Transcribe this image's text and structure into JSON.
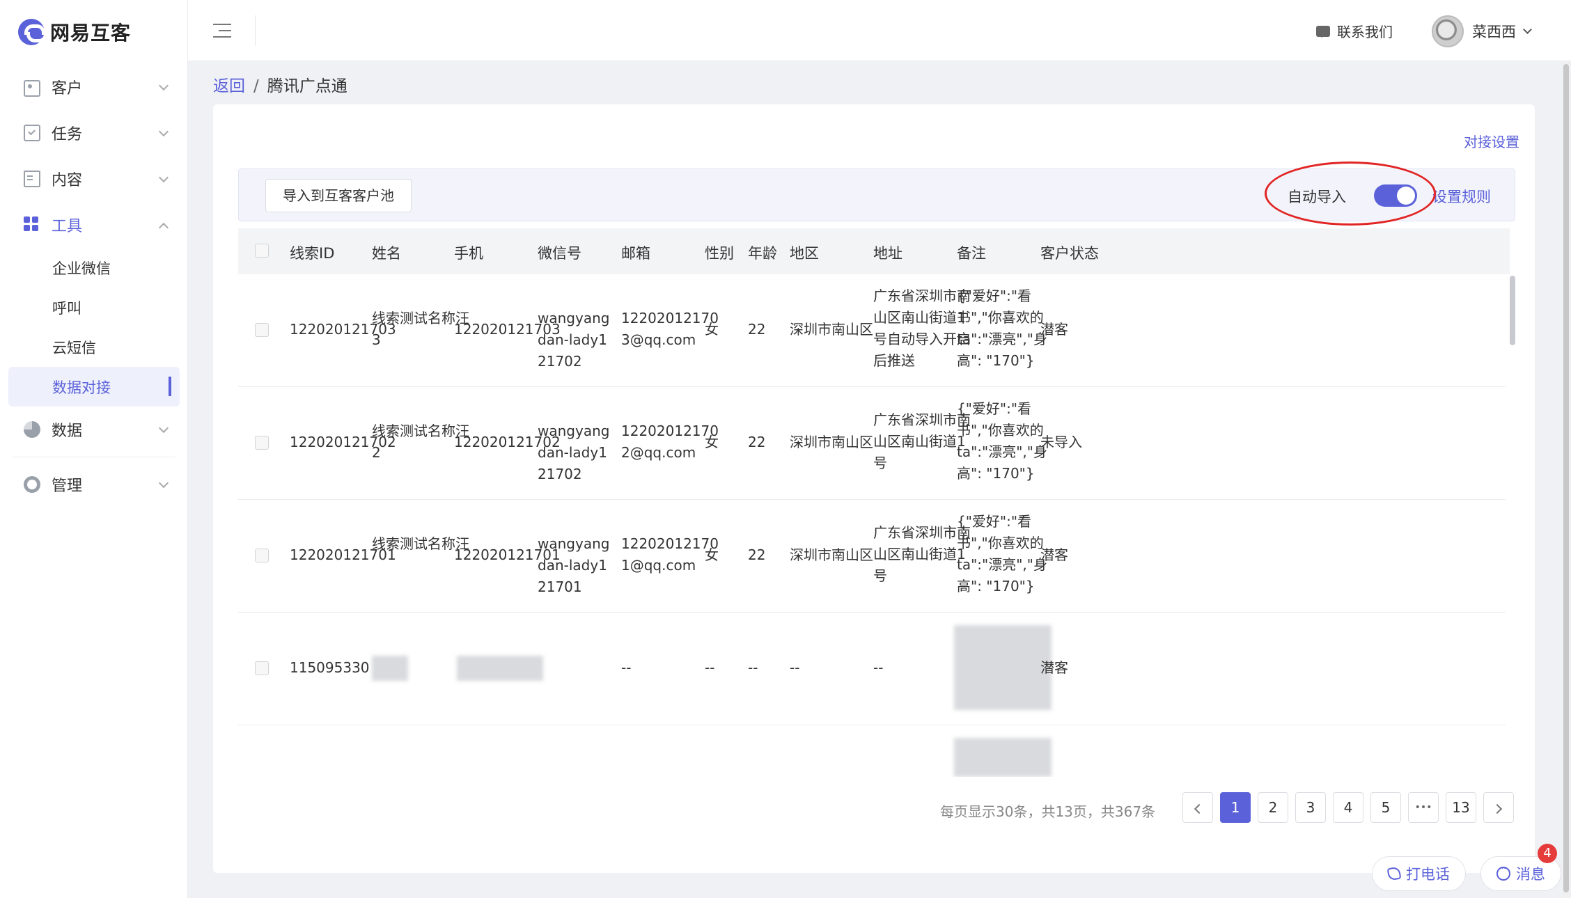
{
  "brand": {
    "name": "网易互客"
  },
  "sidebar": {
    "items": [
      {
        "label": "客户"
      },
      {
        "label": "任务"
      },
      {
        "label": "内容"
      },
      {
        "label": "工具"
      },
      {
        "label": "数据"
      },
      {
        "label": "管理"
      }
    ],
    "tools_sub": [
      {
        "label": "企业微信"
      },
      {
        "label": "呼叫"
      },
      {
        "label": "云短信"
      },
      {
        "label": "数据对接"
      }
    ]
  },
  "header": {
    "contact_label": "联系我们",
    "user_name": "菜西西"
  },
  "breadcrumb": {
    "back": "返回",
    "sep": "/",
    "current": "腾讯广点通"
  },
  "card": {
    "conn_settings": "对接设置",
    "import_button": "导入到互客客户池",
    "auto_import_label": "自动导入",
    "auto_import_on": true,
    "rules_link": "设置规则"
  },
  "table": {
    "headers": [
      "线索ID",
      "姓名",
      "手机",
      "微信号",
      "邮箱",
      "性别",
      "年龄",
      "地区",
      "地址",
      "备注",
      "客户状态"
    ],
    "rows": [
      {
        "id": "122020121703",
        "name": "线索测试名称汪3",
        "phone": "122020121703",
        "wechat": "wangyangdan-lady121702",
        "email": "122020121703@qq.com",
        "gender": "女",
        "age": "22",
        "region": "深圳市南山区",
        "address": "广东省深圳市南山区南山街道1号自动导入开启后推送",
        "note": "{\"爱好\":\"看书\",\"你喜欢的ta\":\"漂亮\",\"身高\": \"170\"}",
        "status": "潜客"
      },
      {
        "id": "122020121702",
        "name": "线索测试名称汪2",
        "phone": "122020121702",
        "wechat": "wangyangdan-lady121702",
        "email": "122020121702@qq.com",
        "gender": "女",
        "age": "22",
        "region": "深圳市南山区",
        "address": "广东省深圳市南山区南山街道1号",
        "note": "{\"爱好\":\"看书\",\"你喜欢的ta\":\"漂亮\",\"身高\": \"170\"}",
        "status": "未导入"
      },
      {
        "id": "122020121701",
        "name": "线索测试名称汪",
        "phone": "122020121701",
        "wechat": "wangyangdan-lady121701",
        "email": "122020121701@qq.com",
        "gender": "女",
        "age": "22",
        "region": "深圳市南山区",
        "address": "广东省深圳市南山区南山街道1号",
        "note": "{\"爱好\":\"看书\",\"你喜欢的ta\":\"漂亮\",\"身高\": \"170\"}",
        "status": "潜客"
      },
      {
        "id": "115095330",
        "email": "--",
        "gender": "--",
        "age": "--",
        "region": "--",
        "address": "--",
        "status": "潜客"
      }
    ]
  },
  "pagination": {
    "info": "每页显示30条，共13页，共367条",
    "pages": [
      "1",
      "2",
      "3",
      "4",
      "5",
      "•••",
      "13"
    ],
    "current": "1"
  },
  "floating": {
    "call_label": "打电话",
    "message_label": "消息",
    "message_badge": "4"
  },
  "colors": {
    "accent": "#5b61d9",
    "highlight_ring": "#e12525"
  }
}
